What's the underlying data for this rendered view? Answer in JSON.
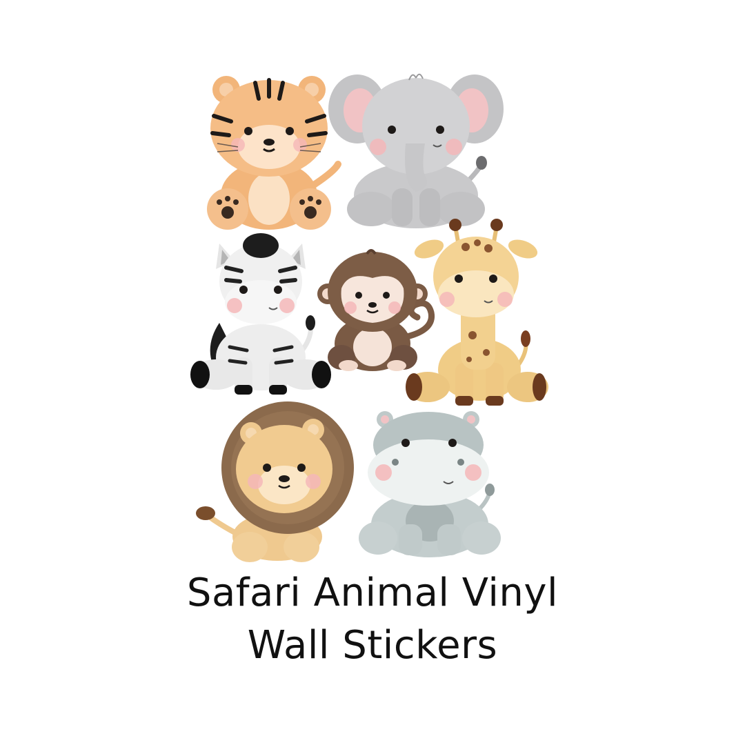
{
  "caption": {
    "line1": "Safari Animal Vinyl",
    "line2": "Wall Stickers"
  },
  "stickers": [
    {
      "animal": "tiger",
      "icon": "tiger-icon"
    },
    {
      "animal": "elephant",
      "icon": "elephant-icon"
    },
    {
      "animal": "zebra",
      "icon": "zebra-icon"
    },
    {
      "animal": "monkey",
      "icon": "monkey-icon"
    },
    {
      "animal": "giraffe",
      "icon": "giraffe-icon"
    },
    {
      "animal": "lion",
      "icon": "lion-icon"
    },
    {
      "animal": "hippo",
      "icon": "hippo-icon"
    }
  ],
  "colors": {
    "background": "#ffffff",
    "text": "#111111",
    "tiger": "#f2b57a",
    "elephant": "#c9c9cb",
    "zebra": "#ededed",
    "monkey": "#7a5a44",
    "giraffe": "#f0cc86",
    "lion_mane": "#8b6a4c",
    "lion": "#efc98f",
    "hippo": "#c3cdcd",
    "cheek": "#f5b7b8"
  }
}
